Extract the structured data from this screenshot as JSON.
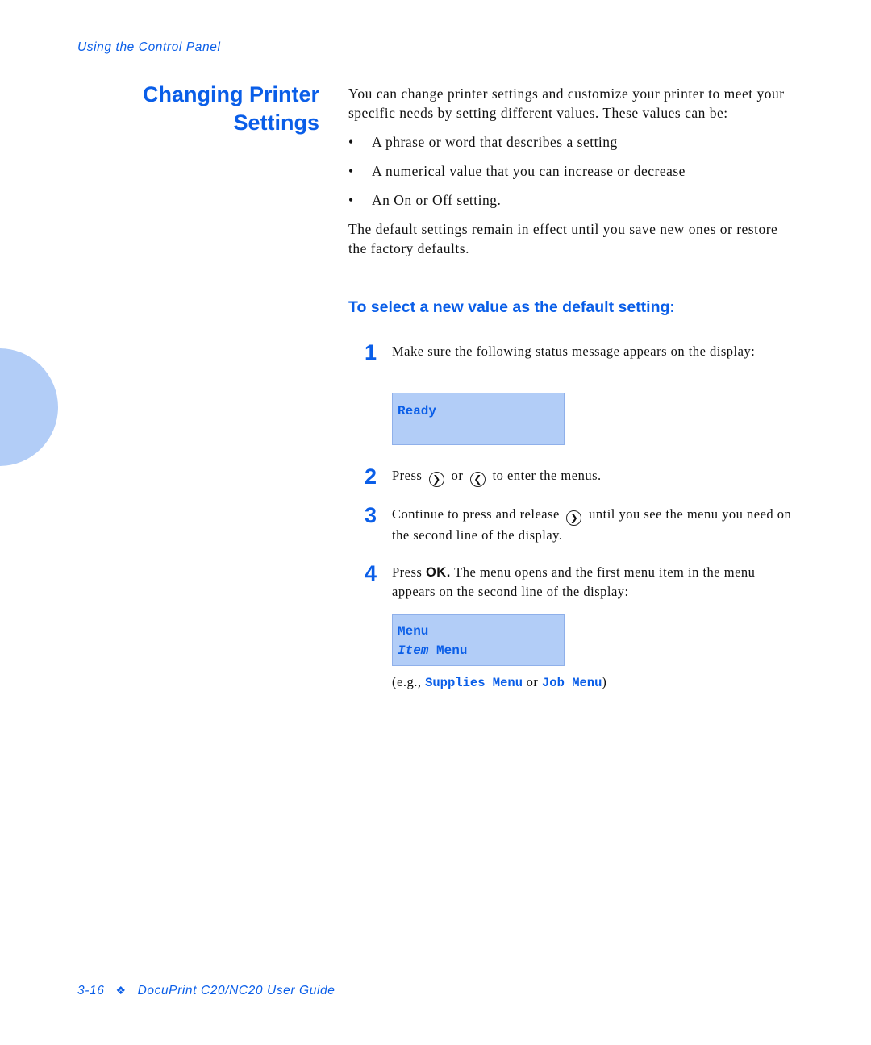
{
  "header": {
    "running_title": "Using the Control Panel"
  },
  "section": {
    "title_line1": "Changing Printer",
    "title_line2": "Settings",
    "intro": "You can change printer settings and customize your printer to meet your specific needs by setting different values. These values can be:",
    "bullets": [
      "A phrase or word that describes a setting",
      "A numerical value that you can increase or decrease",
      "An On or Off setting."
    ],
    "bullet_glyph": "•",
    "defaults_note": "The default settings remain in effect until you save new ones or restore the factory defaults."
  },
  "procedure": {
    "heading": "To select a new value as the default setting:",
    "steps": [
      {
        "number": "1",
        "text": "Make sure the following status message appears on the display:"
      },
      {
        "number": "2",
        "text_before": "Press",
        "text_mid": "or",
        "text_after": "to enter the menus.",
        "icons": [
          "right-arrow-button",
          "left-arrow-button"
        ]
      },
      {
        "number": "3",
        "text_before": "Continue to press and release",
        "text_after": "until you see the menu you need on the second line of the display.",
        "icons": [
          "right-arrow-button"
        ]
      },
      {
        "number": "4",
        "text_before": "Press",
        "ok_label": "OK.",
        "text_after": "The menu opens and the first menu item in the menu appears on the second line of the display:"
      }
    ],
    "display_ready": {
      "line1": "Ready"
    },
    "display_menu": {
      "line1": "Menu",
      "line2_italic": "Item",
      "line2_rest": "Menu"
    },
    "example": {
      "prefix": "(e.g.,",
      "item1": "Supplies Menu",
      "connector": "or",
      "item2": "Job Menu",
      "suffix": ")"
    }
  },
  "icons": {
    "right_arrow": "❯",
    "left_arrow": "❮",
    "footer_separator": "❖"
  },
  "footer": {
    "page_number": "3-16",
    "guide_title": "DocuPrint C20/NC20 User Guide"
  },
  "colors": {
    "accent": "#0a5ee8",
    "lcd_background": "#b2cdf7",
    "side_tab": "#b2cdf7"
  }
}
